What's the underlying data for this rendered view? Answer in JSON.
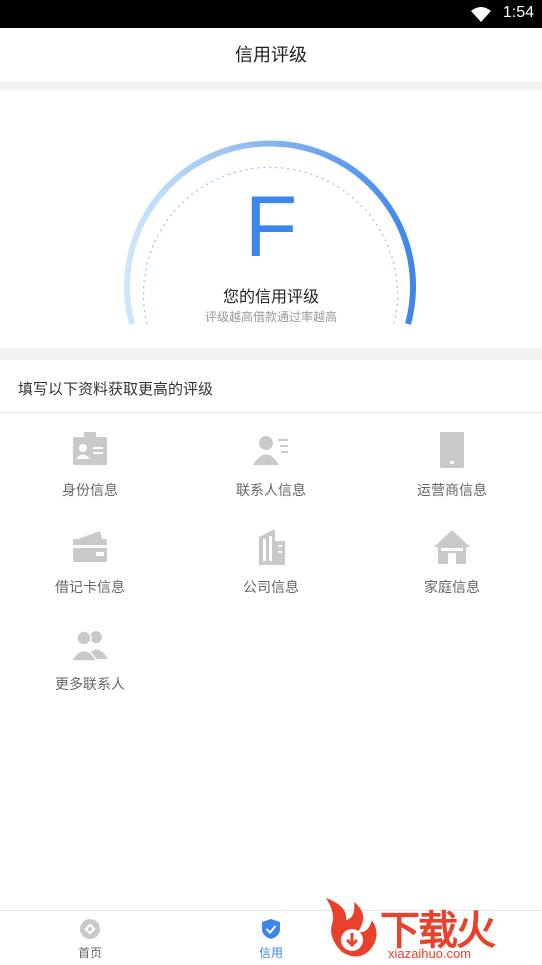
{
  "status_bar": {
    "time": "1:54"
  },
  "header": {
    "title": "信用评级"
  },
  "rating": {
    "grade": "F",
    "label": "您的信用评级",
    "sub": "评级越高借款通过率越高",
    "arc_color_start": "#cfe6fb",
    "arc_color_end": "#3d86ea"
  },
  "section": {
    "title": "填写以下资料获取更高的评级"
  },
  "items": [
    {
      "label": "身份信息",
      "icon": "id-card-icon"
    },
    {
      "label": "联系人信息",
      "icon": "contact-icon"
    },
    {
      "label": "运营商信息",
      "icon": "phone-icon"
    },
    {
      "label": "借记卡信息",
      "icon": "wallet-icon"
    },
    {
      "label": "公司信息",
      "icon": "building-icon"
    },
    {
      "label": "家庭信息",
      "icon": "house-icon"
    },
    {
      "label": "更多联系人",
      "icon": "people-icon"
    }
  ],
  "bottom_nav": {
    "tabs": [
      {
        "label": "首页",
        "icon": "home-icon",
        "active": false
      },
      {
        "label": "信用",
        "icon": "shield-check-icon",
        "active": true
      }
    ]
  },
  "watermark": {
    "text_cn": "下载火",
    "text_en": "xiazaihuo.com"
  },
  "colors": {
    "accent": "#3d86ea",
    "icon_gray": "#c9c9c9",
    "watermark": "#e8412c"
  }
}
